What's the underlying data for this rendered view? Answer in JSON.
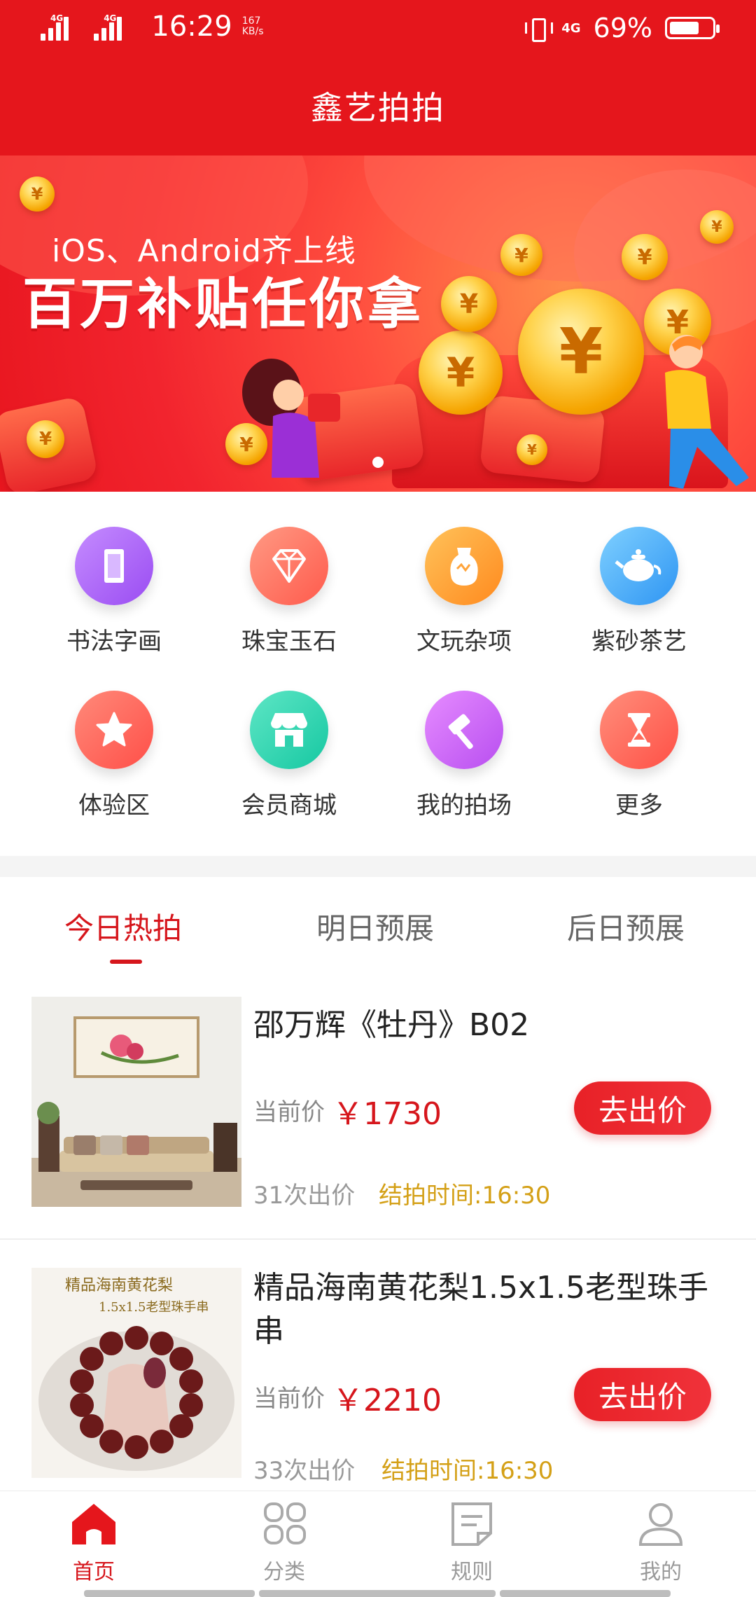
{
  "status_bar": {
    "network_left_1": "4G",
    "network_left_2": "4G",
    "time": "16:29",
    "speed": "167 KB/s",
    "network_right": "4G",
    "battery_text": "69%",
    "battery_level": 0.69
  },
  "header": {
    "title": "鑫艺拍拍"
  },
  "banner": {
    "subtitle": "iOS、Android齐上线",
    "headline": "百万补贴任你拿",
    "active_dot": 1,
    "total_dots": 1
  },
  "categories": [
    {
      "label": "书法字画",
      "icon": "scroll-icon",
      "color_from": "#c58cff",
      "color_to": "#9a4cf2"
    },
    {
      "label": "珠宝玉石",
      "icon": "diamond-icon",
      "color_from": "#ff9a84",
      "color_to": "#ff5a4c"
    },
    {
      "label": "文玩杂项",
      "icon": "vase-icon",
      "color_from": "#ffc25a",
      "color_to": "#ff8a1e"
    },
    {
      "label": "紫砂茶艺",
      "icon": "teapot-icon",
      "color_from": "#7fd0ff",
      "color_to": "#2e95f3"
    },
    {
      "label": "体验区",
      "icon": "star-icon",
      "color_from": "#ff8a7a",
      "color_to": "#ff4f48"
    },
    {
      "label": "会员商城",
      "icon": "store-icon",
      "color_from": "#5ee6c5",
      "color_to": "#16c8a2"
    },
    {
      "label": "我的拍场",
      "icon": "gavel-icon",
      "color_from": "#e68cff",
      "color_to": "#b84ef0"
    },
    {
      "label": "更多",
      "icon": "hourglass-icon",
      "color_from": "#ff8f7c",
      "color_to": "#ff5046"
    }
  ],
  "tabs": [
    {
      "label": "今日热拍",
      "active": true
    },
    {
      "label": "明日预展",
      "active": false
    },
    {
      "label": "后日预展",
      "active": false
    }
  ],
  "items": [
    {
      "title": "邵万辉《牡丹》B02",
      "price_label": "当前价",
      "price": "￥1730",
      "bid_button": "去出价",
      "bids": "31次出价",
      "end_time": "结拍时间:16:30"
    },
    {
      "title": "精品海南黄花梨1.5x1.5老型珠手串",
      "price_label": "当前价",
      "price": "￥2210",
      "bid_button": "去出价",
      "bids": "33次出价",
      "end_time": "结拍时间:16:30",
      "thumb_caption_1": "精品海南黄花梨",
      "thumb_caption_2": "1.5x1.5老型珠手串"
    }
  ],
  "bottom_nav": [
    {
      "label": "首页",
      "icon": "home-icon",
      "active": true
    },
    {
      "label": "分类",
      "icon": "grid-icon",
      "active": false
    },
    {
      "label": "规则",
      "icon": "document-icon",
      "active": false
    },
    {
      "label": "我的",
      "icon": "user-icon",
      "active": false
    }
  ],
  "colors": {
    "brand_red": "#e5161c",
    "accent_red": "#d6161c",
    "gold_text": "#d4a017"
  }
}
